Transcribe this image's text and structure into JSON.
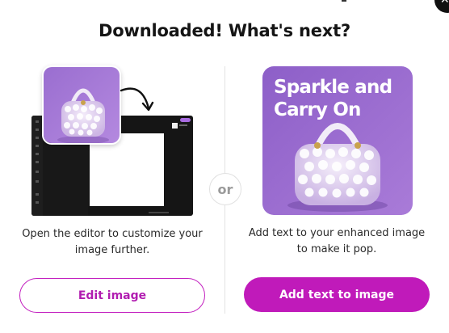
{
  "dialog": {
    "title": "Downloaded! What's next?",
    "close_icon": "close-icon",
    "divider_label": "or",
    "accent_color": "#c01aba",
    "left": {
      "description": "Open the editor to customize your image further.",
      "button_label": "Edit image"
    },
    "right": {
      "overlay_line1": "Sparkle and",
      "overlay_line2": "Carry On",
      "description": "Add text to your enhanced image to make it pop.",
      "button_label": "Add text to image"
    }
  }
}
